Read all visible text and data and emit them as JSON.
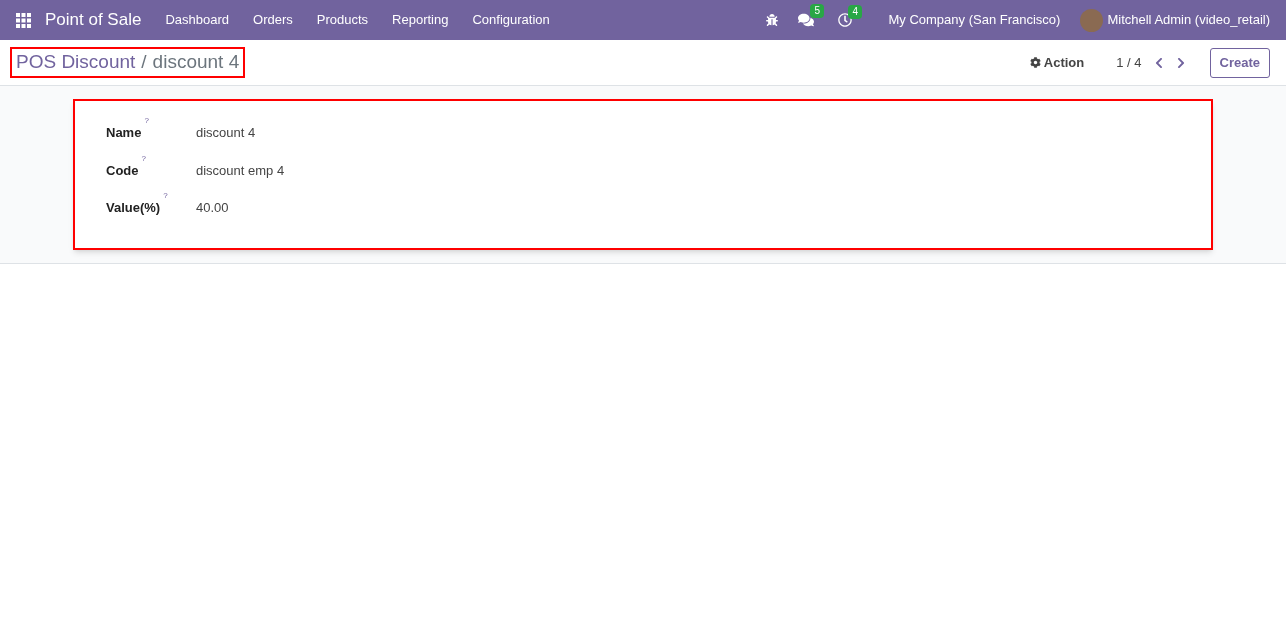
{
  "navbar": {
    "app_name": "Point of Sale",
    "menu": [
      "Dashboard",
      "Orders",
      "Products",
      "Reporting",
      "Configuration"
    ],
    "messages_count": "5",
    "activities_count": "4",
    "company": "My Company (San Francisco)",
    "user": "Mitchell Admin (video_retail)"
  },
  "control_panel": {
    "breadcrumb": {
      "parent": "POS Discount",
      "separator": "/",
      "current": "discount 4"
    },
    "action": "Action",
    "pager": "1 / 4",
    "create": "Create"
  },
  "form": {
    "fields": [
      {
        "label": "Name",
        "help": "?",
        "value": "discount 4"
      },
      {
        "label": "Code",
        "help": "?",
        "value": "discount emp 4"
      },
      {
        "label": "Value(%)",
        "help": "?",
        "value": "40.00"
      }
    ]
  }
}
